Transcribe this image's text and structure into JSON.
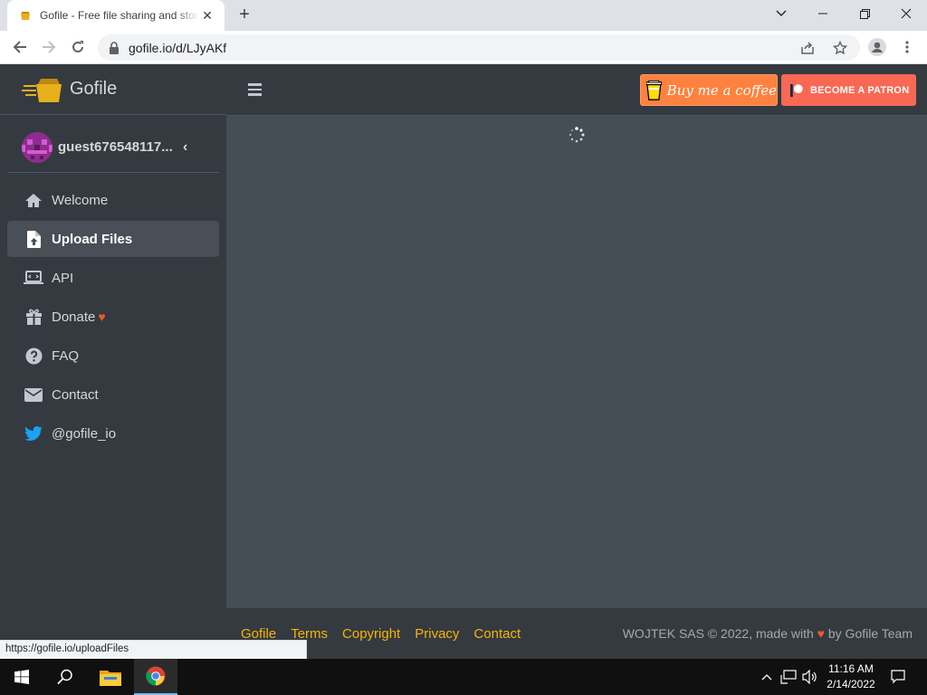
{
  "browser": {
    "tab_title": "Gofile - Free file sharing and storage",
    "url": "gofile.io/d/LJyAKf",
    "status_url": "https://gofile.io/uploadFiles"
  },
  "sidebar": {
    "brand": "Gofile",
    "username": "guest676548117...",
    "items": [
      {
        "label": "Welcome",
        "icon": "home-icon",
        "active": false
      },
      {
        "label": "Upload Files",
        "icon": "file-upload-icon",
        "active": true
      },
      {
        "label": "API",
        "icon": "laptop-code-icon",
        "active": false
      },
      {
        "label": "Donate",
        "icon": "gift-icon",
        "active": false
      },
      {
        "label": "FAQ",
        "icon": "question-circle-icon",
        "active": false
      },
      {
        "label": "Contact",
        "icon": "envelope-icon",
        "active": false
      },
      {
        "label": "@gofile_io",
        "icon": "twitter-icon",
        "active": false
      }
    ]
  },
  "topbar": {
    "coffee_label": "Buy me a coffee",
    "patron_label": "BECOME A PATRON"
  },
  "footer": {
    "links": [
      "Gofile",
      "Terms",
      "Copyright",
      "Privacy",
      "Contact"
    ],
    "credit_prefix": "WOJTEK SAS © 2022, made with",
    "credit_suffix": "by Gofile Team"
  },
  "taskbar": {
    "time": "11:16 AM",
    "date": "2/14/2022"
  },
  "colors": {
    "sidebar": "#343a40",
    "content": "#454d55",
    "link": "#f7b500",
    "heart": "#f15a24",
    "coffee": "#ff813f",
    "patron": "#f96854"
  }
}
